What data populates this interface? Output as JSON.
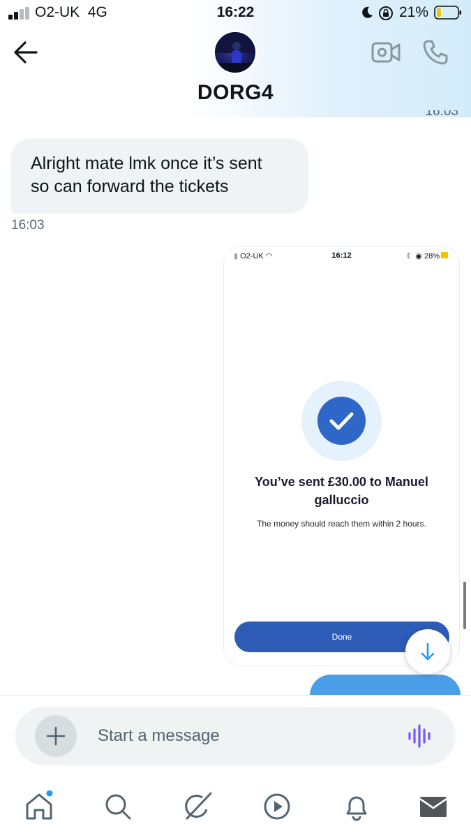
{
  "status_bar": {
    "carrier": "O2-UK",
    "network": "4G",
    "time": "16:22",
    "battery": "21%",
    "battery_level": 0.21
  },
  "header": {
    "contact_name": "DORG4"
  },
  "messages": {
    "partial_timestamp": "16:03",
    "received_text_line1": "Alright mate lmk once it’s sent",
    "received_text_line2": "so can forward the tickets",
    "received_time": "16:03"
  },
  "embedded_screenshot": {
    "carrier": "O2-UK",
    "time": "16:12",
    "battery": "28%",
    "title_line1": "You’ve sent £30.00 to Manuel",
    "title_line2": "galluccio",
    "subtitle": "The money should reach them within 2 hours.",
    "done_label": "Done"
  },
  "composer": {
    "placeholder": "Start a message"
  },
  "colors": {
    "accent": "#1d9bf0",
    "bubble_received": "#eff3f4",
    "bubble_sent": "#4a9ee8",
    "done_button": "#2d5cb7",
    "check_circle": "#2f67c8",
    "voice_icon": "#7856ff"
  },
  "tabs": [
    "home-icon",
    "search-icon",
    "grok-icon",
    "play-icon",
    "bell-icon",
    "mail-icon"
  ]
}
